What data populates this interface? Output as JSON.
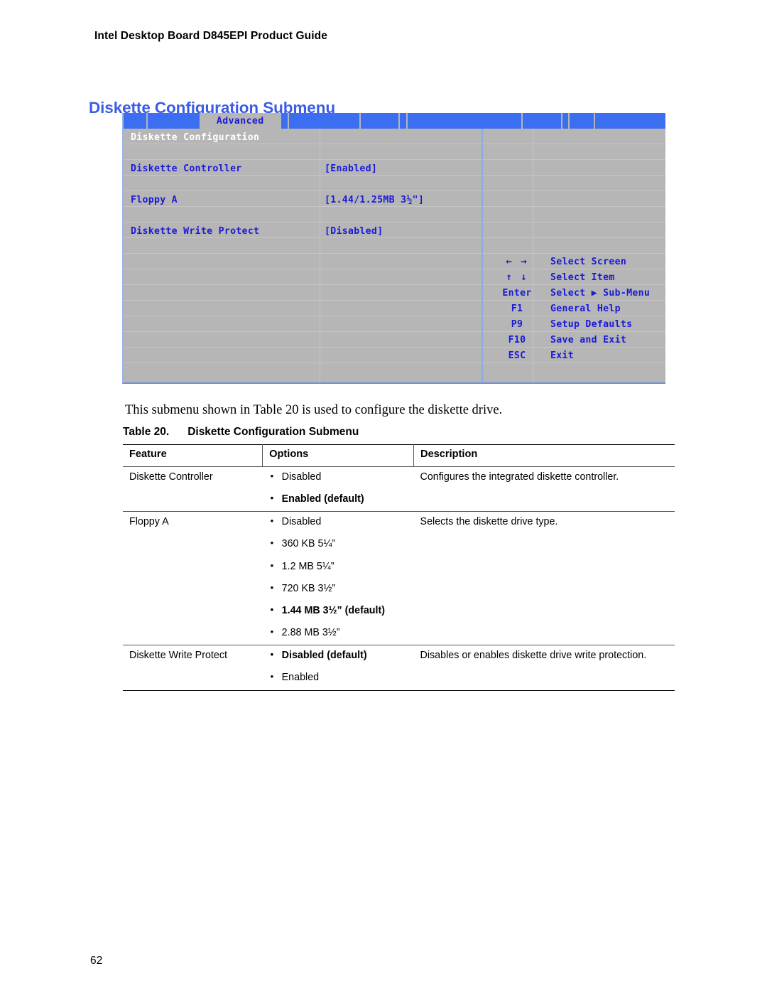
{
  "document": {
    "running_header": "Intel Desktop Board D845EPI Product Guide",
    "section_heading": "Diskette Configuration Submenu",
    "body_paragraph": "This submenu shown in Table 20 is used to configure the diskette drive.",
    "page_number": "62",
    "heading_color": "#3b5ce8"
  },
  "bios": {
    "active_tab": "Advanced",
    "panel_title": "Diskette Configuration",
    "items": [
      {
        "label": "Diskette Controller",
        "value": "[Enabled]"
      },
      {
        "label": "Floppy A",
        "value": "[1.44/1.25MB 3½\"]"
      },
      {
        "label": "Diskette Write Protect",
        "value": "[Disabled]"
      }
    ],
    "legend": [
      {
        "key": "← →",
        "desc": "Select Screen"
      },
      {
        "key": "↑ ↓",
        "desc": "Select Item"
      },
      {
        "key": "Enter",
        "desc": "Select ▶ Sub-Menu"
      },
      {
        "key": "F1",
        "desc": "General Help"
      },
      {
        "key": "P9",
        "desc": "Setup Defaults"
      },
      {
        "key": "F10",
        "desc": "Save and Exit"
      },
      {
        "key": "ESC",
        "desc": "Exit"
      }
    ],
    "colors": {
      "bar_blue": "#3b6ef0",
      "body_gray": "#b6b6b6",
      "text_blue": "#1a1ad8",
      "title_white": "#ffffff"
    }
  },
  "table": {
    "caption_number": "Table 20.",
    "caption_title": "Diskette Configuration Submenu",
    "headers": [
      "Feature",
      "Options",
      "Description"
    ],
    "rows": [
      {
        "feature": "Diskette Controller",
        "options": [
          {
            "text": "Disabled",
            "default": false
          },
          {
            "text": "Enabled (default)",
            "default": true
          }
        ],
        "description": "Configures the integrated diskette controller."
      },
      {
        "feature": "Floppy A",
        "options": [
          {
            "text": "Disabled",
            "default": false
          },
          {
            "text": "360 KB 5¼”",
            "default": false
          },
          {
            "text": "1.2 MB 5¼”",
            "default": false
          },
          {
            "text": "720 KB 3½”",
            "default": false
          },
          {
            "text": "1.44 MB 3½” (default)",
            "default": true
          },
          {
            "text": "2.88 MB 3½”",
            "default": false
          }
        ],
        "description": "Selects the diskette drive type."
      },
      {
        "feature": "Diskette Write Protect",
        "options": [
          {
            "text": "Disabled (default)",
            "default": true
          },
          {
            "text": "Enabled",
            "default": false
          }
        ],
        "description": "Disables or enables diskette drive write protection."
      }
    ]
  }
}
